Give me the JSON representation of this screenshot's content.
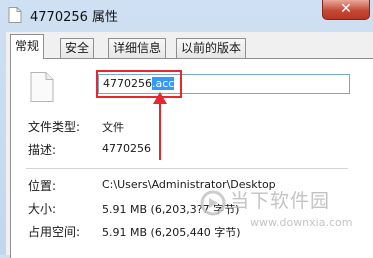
{
  "window": {
    "title": "4770256 属性",
    "close_label": "✕"
  },
  "tabs": [
    {
      "label": "常规"
    },
    {
      "label": "安全"
    },
    {
      "label": "详细信息"
    },
    {
      "label": "以前的版本"
    }
  ],
  "general": {
    "filename_base": "4770256",
    "filename_ext_selected": ".acc",
    "file_type_label": "文件类型:",
    "file_type_value": "文件",
    "description_label": "描述:",
    "description_value": "4770256",
    "location_label": "位置:",
    "location_value": "C:\\Users\\Administrator\\Desktop",
    "size_label": "大小:",
    "size_value": "5.91 MB (6,203,3?7 字节)",
    "disk_size_label": "占用空间:",
    "disk_size_value": "5.91 MB (6,205,440 字节)"
  },
  "annotation": {
    "color": "#e8262d"
  },
  "watermark": {
    "brand": "当下软件园",
    "site": "www.downxia.com"
  }
}
